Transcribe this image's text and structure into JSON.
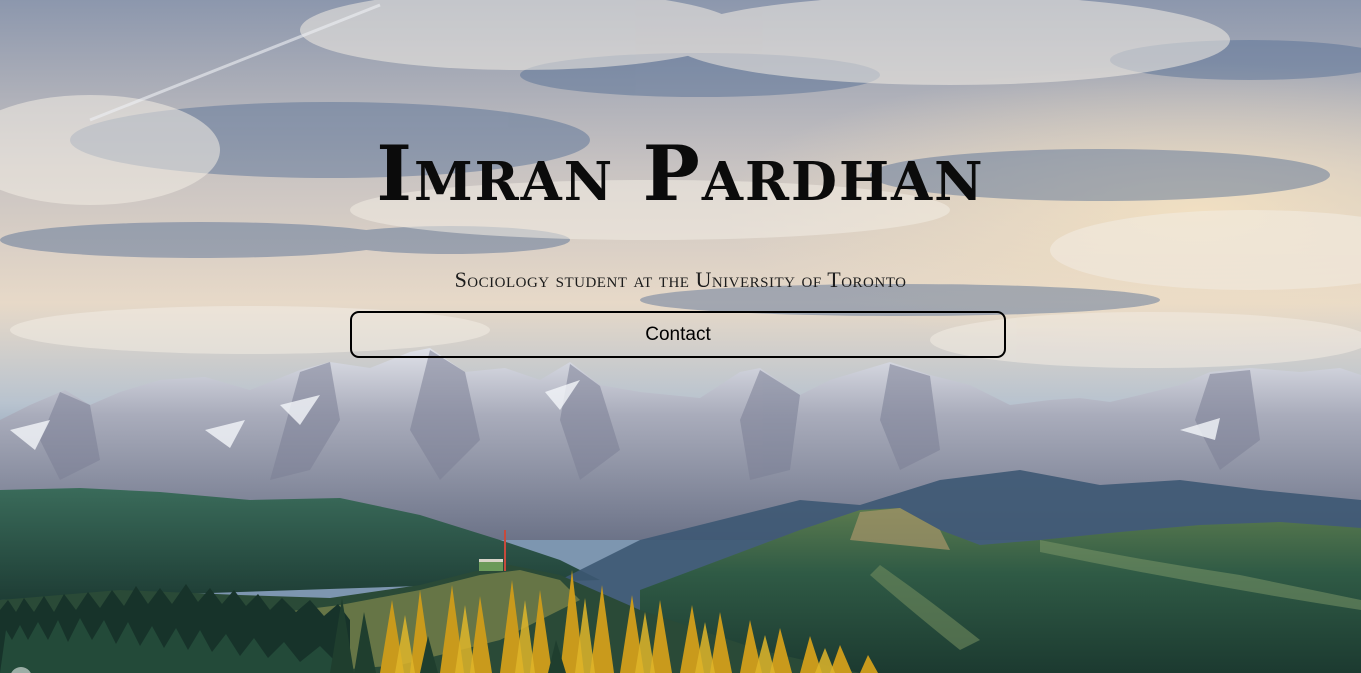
{
  "hero": {
    "title": "Imran Pardhan",
    "subtitle": "Sociology student at the University of Toronto",
    "contact_label": "Contact",
    "background": "mountain-landscape-photo"
  },
  "colors": {
    "title_text": "#0b0b0b",
    "button_border": "#000000",
    "sky_blue": "#5a7fa8",
    "snow": "#d8dbe2",
    "forest": "#1f4a3a",
    "larch_gold": "#c99a1c"
  }
}
